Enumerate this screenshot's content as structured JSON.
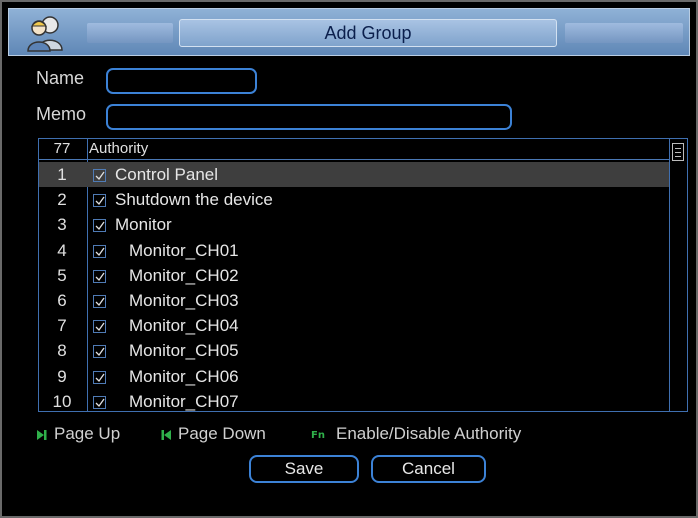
{
  "window": {
    "title": "Add Group"
  },
  "form": {
    "name_label": "Name",
    "name_value": "",
    "memo_label": "Memo",
    "memo_value": ""
  },
  "table": {
    "count": "77",
    "header": "Authority",
    "rows": [
      {
        "num": "1",
        "label": "Control Panel",
        "checked": true,
        "indent": 0,
        "selected": true
      },
      {
        "num": "2",
        "label": "Shutdown the device",
        "checked": true,
        "indent": 0
      },
      {
        "num": "3",
        "label": "Monitor",
        "checked": true,
        "indent": 0
      },
      {
        "num": "4",
        "label": "Monitor_CH01",
        "checked": true,
        "indent": 1
      },
      {
        "num": "5",
        "label": "Monitor_CH02",
        "checked": true,
        "indent": 1
      },
      {
        "num": "6",
        "label": "Monitor_CH03",
        "checked": true,
        "indent": 1
      },
      {
        "num": "7",
        "label": "Monitor_CH04",
        "checked": true,
        "indent": 1
      },
      {
        "num": "8",
        "label": "Monitor_CH05",
        "checked": true,
        "indent": 1
      },
      {
        "num": "9",
        "label": "Monitor_CH06",
        "checked": true,
        "indent": 1
      },
      {
        "num": "10",
        "label": "Monitor_CH07",
        "checked": true,
        "indent": 1
      }
    ]
  },
  "legend": {
    "page_up": "Page Up",
    "page_down": "Page Down",
    "fn_icon": "Fn",
    "enable_disable": "Enable/Disable Authority"
  },
  "buttons": {
    "save": "Save",
    "cancel": "Cancel"
  },
  "colors": {
    "accent": "#3c82d6",
    "legend_green": "#2fb04a",
    "title_gradient_top": "#8fb1d6"
  },
  "icons": {
    "title": "users-icon",
    "page_up": "next-page-icon",
    "page_down": "prev-page-icon",
    "fn": "fn-key-icon"
  }
}
